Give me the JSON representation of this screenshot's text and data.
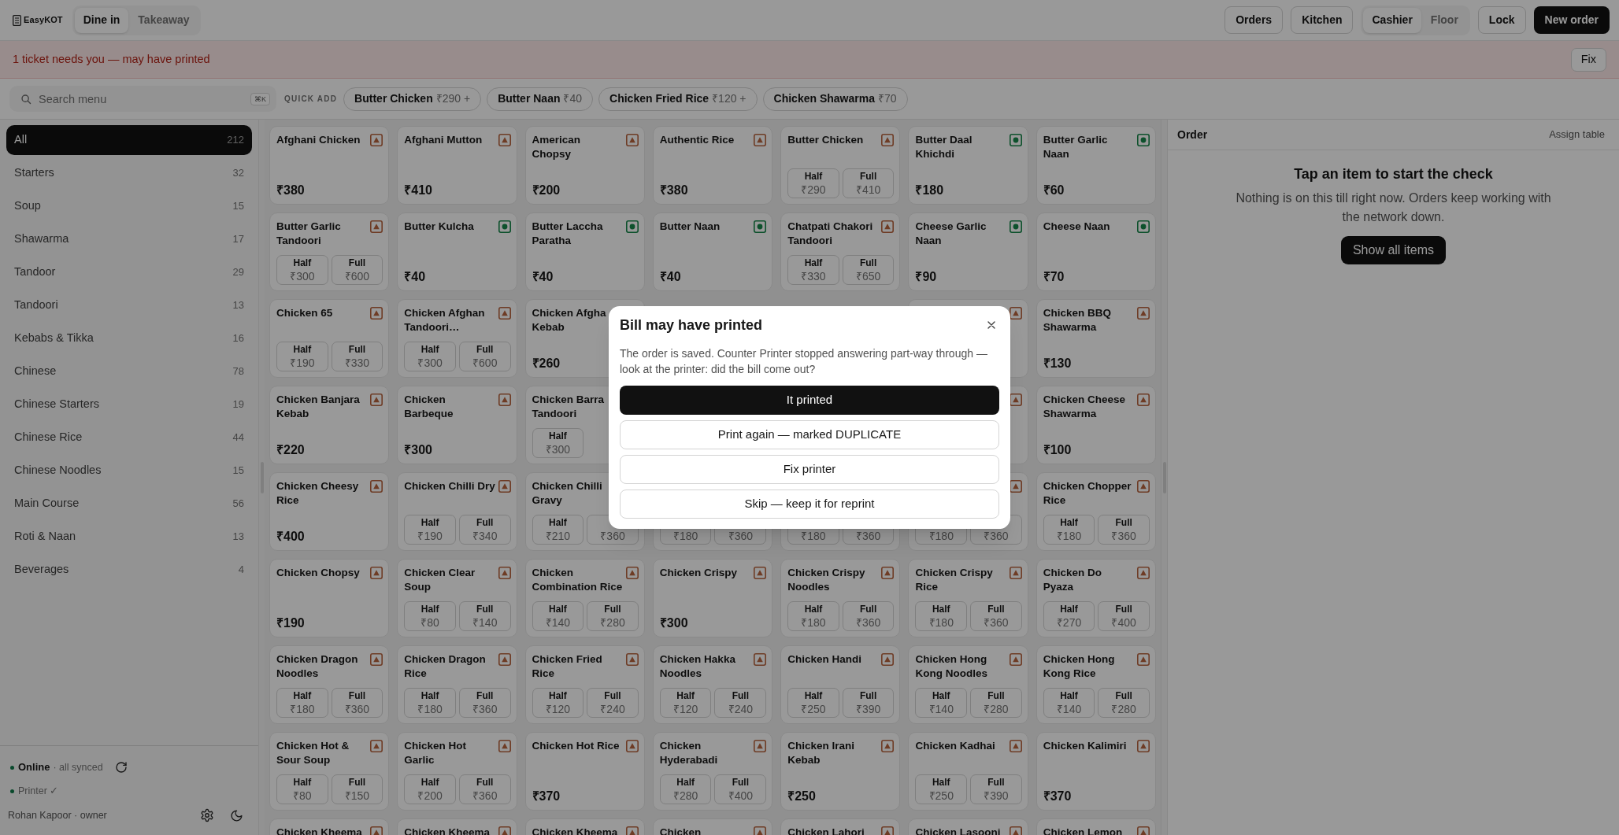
{
  "app": {
    "name": "EasyKOT"
  },
  "order_types": [
    {
      "label": "Dine in",
      "selected": true
    },
    {
      "label": "Takeaway",
      "selected": false
    }
  ],
  "header_buttons": [
    {
      "label": "Orders"
    },
    {
      "label": "Kitchen"
    }
  ],
  "roles": [
    {
      "label": "Cashier",
      "selected": true
    },
    {
      "label": "Floor",
      "selected": false
    }
  ],
  "lock_button": {
    "label": "Lock"
  },
  "new_order_button": {
    "label": "New order"
  },
  "alert": {
    "message": "1 ticket needs you — may have printed",
    "action": "Fix"
  },
  "search": {
    "placeholder": "Search menu",
    "shortcut": "⌘K"
  },
  "quick_add": {
    "label": "QUICK ADD",
    "items": [
      {
        "name": "Butter Chicken",
        "price": "₹290 +"
      },
      {
        "name": "Butter Naan",
        "price": "₹40"
      },
      {
        "name": "Chicken Fried Rice",
        "price": "₹120 +"
      },
      {
        "name": "Chicken Shawarma",
        "price": "₹70"
      }
    ]
  },
  "categories": [
    {
      "label": "All",
      "count": "212",
      "selected": true
    },
    {
      "label": "Starters",
      "count": "32",
      "selected": false
    },
    {
      "label": "Soup",
      "count": "15",
      "selected": false
    },
    {
      "label": "Shawarma",
      "count": "17",
      "selected": false
    },
    {
      "label": "Tandoor",
      "count": "29",
      "selected": false
    },
    {
      "label": "Tandoori",
      "count": "13",
      "selected": false
    },
    {
      "label": "Kebabs & Tikka",
      "count": "16",
      "selected": false
    },
    {
      "label": "Chinese",
      "count": "78",
      "selected": false
    },
    {
      "label": "Chinese Starters",
      "count": "19",
      "selected": false
    },
    {
      "label": "Chinese Rice",
      "count": "44",
      "selected": false
    },
    {
      "label": "Chinese Noodles",
      "count": "15",
      "selected": false
    },
    {
      "label": "Main Course",
      "count": "56",
      "selected": false
    },
    {
      "label": "Roti & Naan",
      "count": "13",
      "selected": false
    },
    {
      "label": "Beverages",
      "count": "4",
      "selected": false
    }
  ],
  "status": {
    "connection": {
      "label": "Online",
      "detail": "· all synced",
      "ok": true
    },
    "printer": {
      "label": "Printer ✓",
      "ok": true
    },
    "user": "Rohan Kapoor · owner"
  },
  "menu_items": [
    {
      "name": "Afghani Chicken",
      "veg": false,
      "kind": "single",
      "price": "₹380"
    },
    {
      "name": "Afghani Mutton",
      "veg": false,
      "kind": "single",
      "price": "₹410"
    },
    {
      "name": "American\nChopsy",
      "veg": false,
      "kind": "single",
      "price": "₹200"
    },
    {
      "name": "Authentic Rice",
      "veg": false,
      "kind": "single",
      "price": "₹380"
    },
    {
      "name": "Butter Chicken",
      "veg": false,
      "kind": "variants",
      "variants": [
        {
          "label": "Half",
          "price": "₹290"
        },
        {
          "label": "Full",
          "price": "₹410"
        }
      ]
    },
    {
      "name": "Butter Daal\nKhichdi",
      "veg": true,
      "kind": "single",
      "price": "₹180"
    },
    {
      "name": "Butter Garlic\nNaan",
      "veg": true,
      "kind": "single",
      "price": "₹60"
    },
    {
      "name": "Butter Garlic\nTandoori",
      "veg": false,
      "kind": "variants",
      "variants": [
        {
          "label": "Half",
          "price": "₹300"
        },
        {
          "label": "Full",
          "price": "₹600"
        }
      ]
    },
    {
      "name": "Butter Kulcha",
      "veg": true,
      "kind": "single",
      "price": "₹40"
    },
    {
      "name": "Butter Laccha\nParatha",
      "veg": true,
      "kind": "single",
      "price": "₹40"
    },
    {
      "name": "Butter Naan",
      "veg": true,
      "kind": "single",
      "price": "₹40"
    },
    {
      "name": "Chatpati Chakori\nTandoori",
      "veg": false,
      "kind": "variants",
      "variants": [
        {
          "label": "Half",
          "price": "₹330"
        },
        {
          "label": "Full",
          "price": "₹650"
        }
      ]
    },
    {
      "name": "Cheese Garlic\nNaan",
      "veg": true,
      "kind": "single",
      "price": "₹90"
    },
    {
      "name": "Cheese Naan",
      "veg": true,
      "kind": "single",
      "price": "₹70"
    },
    {
      "name": "Chicken 65",
      "veg": false,
      "kind": "variants",
      "variants": [
        {
          "label": "Half",
          "price": "₹190"
        },
        {
          "label": "Full",
          "price": "₹330"
        }
      ]
    },
    {
      "name": "Chicken Afghan\nTandoori…",
      "veg": false,
      "kind": "variants",
      "variants": [
        {
          "label": "Half",
          "price": "₹300"
        },
        {
          "label": "Full",
          "price": "₹600"
        }
      ]
    },
    {
      "name": "Chicken Afgha\nKebab",
      "kind": "single",
      "price": "₹260"
    },
    {
      "kind": "covered"
    },
    {
      "kind": "covered"
    },
    {
      "veg": false,
      "kind": "covered_edge"
    },
    {
      "name": "Chicken BBQ\nShawarma",
      "veg": false,
      "kind": "single",
      "price": "₹130"
    },
    {
      "name": "Chicken Banjara\nKebab",
      "veg": false,
      "kind": "single",
      "price": "₹220"
    },
    {
      "name": "Chicken\nBarbeque",
      "veg": false,
      "kind": "single",
      "price": "₹300"
    },
    {
      "name": "Chicken Barra\nTandoori",
      "kind": "variants",
      "variants": [
        {
          "label": "Half",
          "price": "₹300"
        }
      ]
    },
    {
      "kind": "covered"
    },
    {
      "kind": "covered"
    },
    {
      "veg": false,
      "kind": "covered_edge"
    },
    {
      "name": "Chicken Cheese\nShawarma",
      "veg": false,
      "kind": "single",
      "price": "₹100"
    },
    {
      "name": "Chicken Cheesy\nRice",
      "veg": false,
      "kind": "single",
      "price": "₹400"
    },
    {
      "name": "Chicken Chilli Dry",
      "veg": false,
      "kind": "variants",
      "variants": [
        {
          "label": "Half",
          "price": "₹190"
        },
        {
          "label": "Full",
          "price": "₹340"
        }
      ]
    },
    {
      "name": "Chicken Chilli\nGravy",
      "kind": "variants",
      "variants": [
        {
          "label": "Half",
          "price": "₹210"
        },
        {
          "price": "₹360"
        }
      ]
    },
    {
      "kind": "variants",
      "variants": [
        {
          "price": "₹180"
        },
        {
          "price": "₹360"
        }
      ]
    },
    {
      "kind": "variants",
      "variants": [
        {
          "price": "₹180"
        },
        {
          "price": "₹360"
        }
      ]
    },
    {
      "veg": false,
      "kind": "variants",
      "variants": [
        {
          "price": "₹180"
        },
        {
          "price": "₹360"
        }
      ]
    },
    {
      "name": "Chicken Chopper\nRice",
      "veg": false,
      "kind": "variants",
      "variants": [
        {
          "label": "Half",
          "price": "₹180"
        },
        {
          "label": "Full",
          "price": "₹360"
        }
      ]
    },
    {
      "name": "Chicken Chopsy",
      "veg": false,
      "kind": "single",
      "price": "₹190"
    },
    {
      "name": "Chicken Clear\nSoup",
      "veg": false,
      "kind": "variants",
      "variants": [
        {
          "label": "Half",
          "price": "₹80"
        },
        {
          "label": "Full",
          "price": "₹140"
        }
      ]
    },
    {
      "name": "Chicken\nCombination Rice",
      "veg": false,
      "kind": "variants",
      "variants": [
        {
          "label": "Half",
          "price": "₹140"
        },
        {
          "label": "Full",
          "price": "₹280"
        }
      ]
    },
    {
      "name": "Chicken Crispy",
      "veg": false,
      "kind": "single",
      "price": "₹300"
    },
    {
      "name": "Chicken Crispy\nNoodles",
      "veg": false,
      "kind": "variants",
      "variants": [
        {
          "label": "Half",
          "price": "₹180"
        },
        {
          "label": "Full",
          "price": "₹360"
        }
      ]
    },
    {
      "name": "Chicken Crispy\nRice",
      "veg": false,
      "kind": "variants",
      "variants": [
        {
          "label": "Half",
          "price": "₹180"
        },
        {
          "label": "Full",
          "price": "₹360"
        }
      ]
    },
    {
      "name": "Chicken Do\nPyaza",
      "veg": false,
      "kind": "variants",
      "variants": [
        {
          "label": "Half",
          "price": "₹270"
        },
        {
          "label": "Full",
          "price": "₹400"
        }
      ]
    },
    {
      "name": "Chicken Dragon\nNoodles",
      "veg": false,
      "kind": "variants",
      "variants": [
        {
          "label": "Half",
          "price": "₹180"
        },
        {
          "label": "Full",
          "price": "₹360"
        }
      ]
    },
    {
      "name": "Chicken Dragon\nRice",
      "veg": false,
      "kind": "variants",
      "variants": [
        {
          "label": "Half",
          "price": "₹180"
        },
        {
          "label": "Full",
          "price": "₹360"
        }
      ]
    },
    {
      "name": "Chicken Fried\nRice",
      "veg": false,
      "kind": "variants",
      "variants": [
        {
          "label": "Half",
          "price": "₹120"
        },
        {
          "label": "Full",
          "price": "₹240"
        }
      ]
    },
    {
      "name": "Chicken Hakka\nNoodles",
      "veg": false,
      "kind": "variants",
      "variants": [
        {
          "label": "Half",
          "price": "₹120"
        },
        {
          "label": "Full",
          "price": "₹240"
        }
      ]
    },
    {
      "name": "Chicken Handi",
      "veg": false,
      "kind": "variants",
      "variants": [
        {
          "label": "Half",
          "price": "₹250"
        },
        {
          "label": "Full",
          "price": "₹390"
        }
      ]
    },
    {
      "name": "Chicken Hong\nKong Noodles",
      "veg": false,
      "kind": "variants",
      "variants": [
        {
          "label": "Half",
          "price": "₹140"
        },
        {
          "label": "Full",
          "price": "₹280"
        }
      ]
    },
    {
      "name": "Chicken Hong\nKong Rice",
      "veg": false,
      "kind": "variants",
      "variants": [
        {
          "label": "Half",
          "price": "₹140"
        },
        {
          "label": "Full",
          "price": "₹280"
        }
      ]
    },
    {
      "name": "Chicken Hot &\nSour Soup",
      "veg": false,
      "kind": "variants",
      "variants": [
        {
          "label": "Half",
          "price": "₹80"
        },
        {
          "label": "Full",
          "price": "₹150"
        }
      ]
    },
    {
      "name": "Chicken Hot\nGarlic",
      "veg": false,
      "kind": "variants",
      "variants": [
        {
          "label": "Half",
          "price": "₹200"
        },
        {
          "label": "Full",
          "price": "₹360"
        }
      ]
    },
    {
      "name": "Chicken Hot Rice",
      "veg": false,
      "kind": "single",
      "price": "₹370"
    },
    {
      "name": "Chicken\nHyderabadi",
      "veg": false,
      "kind": "variants",
      "variants": [
        {
          "label": "Half",
          "price": "₹280"
        },
        {
          "label": "Full",
          "price": "₹400"
        }
      ]
    },
    {
      "name": "Chicken Irani\nKebab",
      "veg": false,
      "kind": "single",
      "price": "₹250"
    },
    {
      "name": "Chicken Kadhai",
      "veg": false,
      "kind": "variants",
      "variants": [
        {
          "label": "Half",
          "price": "₹250"
        },
        {
          "label": "Full",
          "price": "₹390"
        }
      ]
    },
    {
      "name": "Chicken Kalimiri",
      "veg": false,
      "kind": "single",
      "price": "₹370"
    },
    {
      "name": "Chicken Kheema",
      "veg": false
    },
    {
      "name": "Chicken Kheema",
      "veg": false
    },
    {
      "name": "Chicken Kheema",
      "veg": false
    },
    {
      "name": "Chicken",
      "veg": false
    },
    {
      "name": "Chicken Lahori",
      "veg": false
    },
    {
      "name": "Chicken Lasooni",
      "veg": false
    },
    {
      "name": "Chicken Lemon",
      "veg": false
    }
  ],
  "order_panel": {
    "title": "Order",
    "assign_table": "Assign table",
    "empty_title": "Tap an item to start the check",
    "empty_message": "Nothing is on this till right now. Orders keep working with the network down.",
    "action": "Show all items"
  },
  "dialog": {
    "title": "Bill may have printed",
    "message": "The order is saved. Counter Printer stopped answering part-way through — look at the printer: did the bill come out?",
    "actions": [
      {
        "label": "It printed",
        "primary": true
      },
      {
        "label": "Print again — marked DUPLICATE",
        "primary": false
      },
      {
        "label": "Fix printer",
        "primary": false
      },
      {
        "label": "Skip — keep it for reprint",
        "primary": false
      }
    ]
  }
}
